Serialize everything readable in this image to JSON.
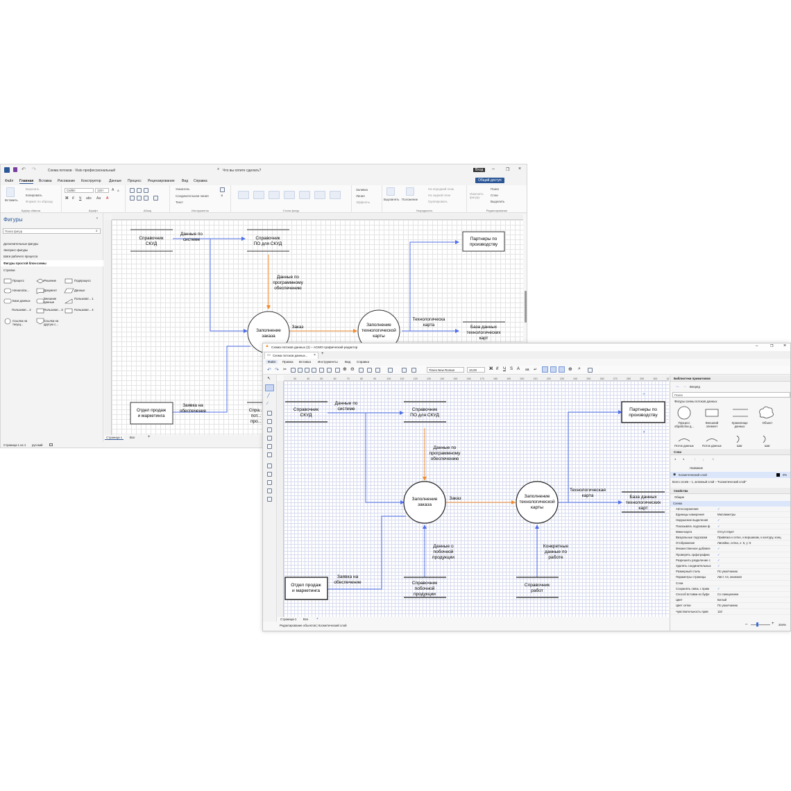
{
  "visio": {
    "title": "Схема потоков  ·  Visio профессиональный",
    "search": "Что вы хотите сделать?",
    "user_badge": "Вход",
    "share": "Общий доступ",
    "menu": [
      "Файл",
      "Главная",
      "Вставка",
      "Рисование",
      "Конструктор",
      "Данные",
      "Процесс",
      "Рецензирование",
      "Вид",
      "Справка"
    ],
    "ribbon": {
      "clipboard": {
        "paste": "Вставить",
        "cut": "Вырезать",
        "copy": "Копировать",
        "format": "Формат по образцу",
        "caption": "Буфер обмена"
      },
      "font": {
        "name": "Calibri",
        "size": "12пт",
        "caption": "Шрифт"
      },
      "paragraph": {
        "caption": "Абзац"
      },
      "tools": {
        "pointer": "Указатель",
        "connector": "Соединительная линия",
        "text": "Текст",
        "caption": "Инструменты"
      },
      "styles": {
        "caption": "Стили фигур",
        "thumb": "Abc"
      },
      "fill": {
        "fill": "Заливка",
        "line": "Линия",
        "effects": "Эффекты"
      },
      "arrange": {
        "align": "Выровнять",
        "position": "Положение",
        "front": "На передний план",
        "back": "На задний план",
        "group": "Группировать",
        "caption": "Упорядочить"
      },
      "edit": {
        "find": "Поиск",
        "layers": "Слои",
        "select": "Выделить",
        "change": "Изменить фигуру",
        "caption": "Редактирование"
      }
    },
    "shapes_panel": {
      "title": "Фигуры",
      "search_placeholder": "Поиск фигур",
      "sections": [
        "Дополнительные фигуры",
        "Экспресс-фигуры",
        "Шаги рабочего процесса",
        "Фигуры простой блок-схемы",
        "Стрелки"
      ],
      "items": [
        "Процесс",
        "Решение",
        "Подпроцесс",
        "Начало/ок...",
        "Документ",
        "Данные",
        "База данных",
        "Внешние данные",
        "Пользоват... 1",
        "Пользоват... 2",
        "Пользоват... 3",
        "Пользоват... 4",
        "Ссылка на текущ...",
        "Ссылка на другую с..."
      ]
    },
    "diagram": {
      "nodes": {
        "skud": "Справочник СКУД",
        "po_skud": "Справочник ПО для СКУД",
        "partners": "Партнеры по производству",
        "order": "Заполнение заказа",
        "techcard": "Заполнение технологической карты",
        "db": "База данных технологических карт",
        "sales": "Отдел продаж и маркетинга",
        "side": "Спра... пот... про..."
      },
      "labels": {
        "system_data": "Данные по системе",
        "software_data": "Данные по программному обеспечению",
        "order": "Заказ",
        "techcard": "Технологическа карта",
        "request": "Заявка на обеспечение"
      }
    },
    "tab": "Страница-1",
    "tab_all": "Все",
    "status": "Страница 1 из 1",
    "language": "русский"
  },
  "ac": {
    "title": "Схема потоков данных (2) – АСМО-графический редактор",
    "doctab": "Схема потоков данных...",
    "menu": [
      "Файл",
      "Правка",
      "Вставка",
      "Инструменты",
      "Вид",
      "Справка"
    ],
    "toolbar": {
      "font": "Times New Roman",
      "size": "10,00"
    },
    "ruler": [
      "30",
      "40",
      "50",
      "60",
      "70",
      "80",
      "90",
      "100",
      "110",
      "120",
      "130",
      "140",
      "150",
      "160",
      "170",
      "180",
      "190",
      "200",
      "210",
      "220",
      "230",
      "240",
      "250",
      "260",
      "270",
      "280",
      "290",
      "300",
      "310"
    ],
    "diagram": {
      "nodes": {
        "skud": "Справочник СКУД",
        "po_skud": "Справочник ПО для СКУД",
        "partners": "Партнеры по производству",
        "order": "Заполнение заказа",
        "techcard": "Заполнение технологической карты",
        "db": "База данных технологических карт",
        "sales": "Отдел продаж и маркетинга",
        "side_product": "Справочник побочной продукции",
        "works": "Справочник работ"
      },
      "labels": {
        "system_data": "Данные по системе",
        "software_data": "Данные по программному обеспечению",
        "order": "Заказ",
        "techcard": "Технологическая карта",
        "request": "Заявка на обеспечение",
        "side_data": "Данные о побочной продукции",
        "works_data": "Конкретные данные по работе"
      }
    },
    "library": {
      "title": "Библиотеки примитивов",
      "back": "Вперёд",
      "search_placeholder": "Поиск",
      "category": "Фигуры схемы потоков данных",
      "items": [
        "Процесс обработки д...",
        "Внешний элемент",
        "Хранилище данных",
        "Объект",
        "Поток данных",
        "Поток данных",
        "Шаг",
        "Шаг"
      ]
    },
    "layers": {
      "title": "Слои",
      "column": "Название",
      "layer": "Косметический слой",
      "percent": "0%",
      "info": "Всего слоёв – 1, активный слой – \"Косметический слой\""
    },
    "properties": {
      "title": "Свойства",
      "tabs": [
        "Общие",
        "Схема"
      ],
      "rows": [
        {
          "k": "Автосохранение",
          "v": "✓"
        },
        {
          "k": "Единицы измерения",
          "v": "Миллиметры"
        },
        {
          "k": "Нарушение выделения",
          "v": "✓"
        },
        {
          "k": "Показывать подсказки ф",
          "v": "✓"
        },
        {
          "k": "Мини-карта",
          "v": "Отсутствует"
        },
        {
          "k": "Визуальные подсказки",
          "v": "Привязка к сетке, к вершинам, к контуру, конц"
        },
        {
          "k": "Отображение",
          "v": "Линейки, сетка, x: 5, y: 5"
        },
        {
          "k": "Множественное добавле",
          "v": "✓"
        },
        {
          "k": "Проверять орфографию",
          "v": "✓"
        },
        {
          "k": "Разрешить разделение с",
          "v": "✓"
        },
        {
          "k": "Удалять соединительных",
          "v": "✓"
        },
        {
          "k": "Размерный стиль",
          "v": "По умолчанию"
        },
        {
          "k": "Параметры страницы",
          "v": "Лист А4, книжная"
        },
        {
          "k": "Слои",
          "v": ""
        },
        {
          "k": "Сохранять связь с прим",
          "v": "✓"
        },
        {
          "k": "Способ вставки из буфе",
          "v": "Со смещением"
        },
        {
          "k": "Цвет",
          "v": "Белый"
        },
        {
          "k": "Цвет сетки",
          "v": "По умолчанию"
        },
        {
          "k": "Чувствительность прив",
          "v": "110"
        }
      ]
    },
    "page_tab": "Страница-1",
    "page_all": "Все",
    "status": "Редактирование объектов  |  Косметический слой",
    "zoom": "204%"
  },
  "colors": {
    "blue": "#4f6fe8",
    "orange": "#f28a2e",
    "accent": "#2b5797",
    "ac_grid": "#d7dbee"
  }
}
